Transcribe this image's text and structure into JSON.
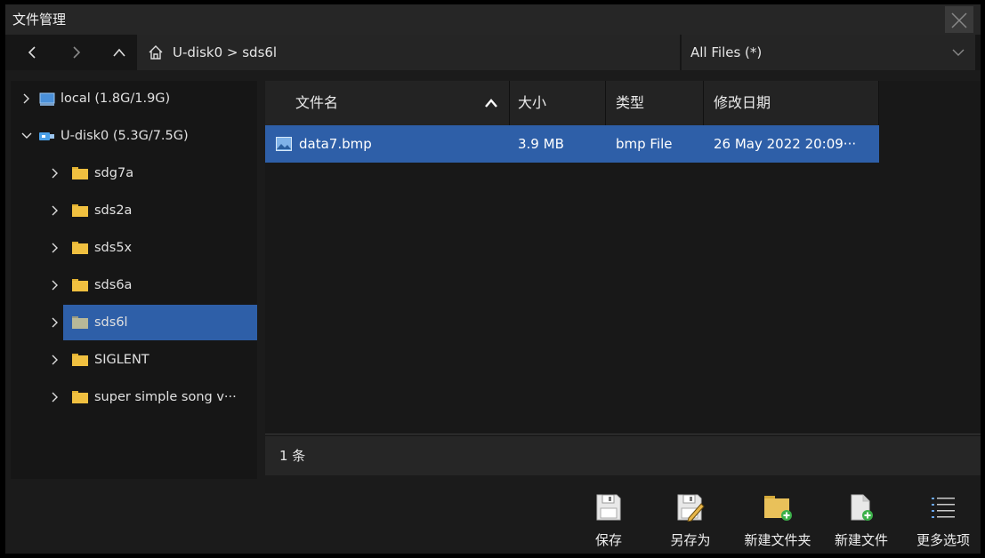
{
  "window": {
    "title": "文件管理"
  },
  "nav": {
    "path": "U-disk0 > sds6l",
    "filter": "All Files (*)",
    "icons": [
      "back-icon",
      "forward-icon",
      "up-icon",
      "home-icon",
      "chevron-down-icon"
    ]
  },
  "tree": [
    {
      "label": "local  (1.8G/1.9G)",
      "icon": "drive-icon",
      "expanded": false
    },
    {
      "label": "U-disk0  (5.3G/7.5G)",
      "icon": "usb-icon",
      "expanded": true
    },
    {
      "label": "sdg7a",
      "icon": "folder-icon"
    },
    {
      "label": "sds2a",
      "icon": "folder-icon"
    },
    {
      "label": "sds5x",
      "icon": "folder-icon"
    },
    {
      "label": "sds6a",
      "icon": "folder-icon"
    },
    {
      "label": "sds6l",
      "icon": "folder-icon",
      "selected": true
    },
    {
      "label": "SIGLENT",
      "icon": "folder-icon"
    },
    {
      "label": "super simple song v···",
      "icon": "folder-icon"
    }
  ],
  "table": {
    "columns": [
      "文件名",
      "大小",
      "类型",
      "修改日期"
    ],
    "sort": "ascending",
    "rows": [
      {
        "name": "data7.bmp",
        "size": "3.9 MB",
        "type": "bmp File",
        "modified": "26 May 2022 20:09···",
        "selected": true
      }
    ]
  },
  "status": "1 条",
  "toolbar": {
    "save": "保存",
    "save_as": "另存为",
    "new_folder": "新建文件夹",
    "new_file": "新建文件",
    "more": "更多选项"
  },
  "colors": {
    "selection": "#2e5fa8",
    "folder": "#f0c040",
    "background": "#1b1b1b"
  }
}
